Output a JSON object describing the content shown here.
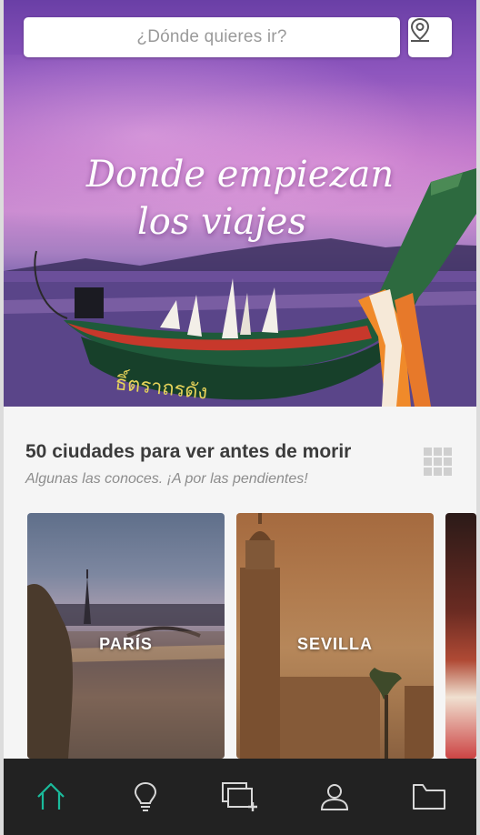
{
  "search": {
    "placeholder": "¿Dónde quieres ir?"
  },
  "hero": {
    "tagline_line1": "Donde empiezan",
    "tagline_line2": "los viajes"
  },
  "section": {
    "title": "50 ciudades para ver antes de morir",
    "subtitle": "Algunas las conoces. ¡A por las pendientes!"
  },
  "cards": [
    {
      "label": "PARÍS"
    },
    {
      "label": "SEVILLA"
    },
    {
      "label": ""
    }
  ],
  "tabbar": {
    "active_color": "#1abc9c",
    "inactive_color": "#d8d8d8",
    "tabs": [
      {
        "icon": "home-icon",
        "active": true
      },
      {
        "icon": "lightbulb-icon",
        "active": false
      },
      {
        "icon": "add-photo-icon",
        "active": false
      },
      {
        "icon": "user-icon",
        "active": false
      },
      {
        "icon": "folder-icon",
        "active": false
      }
    ]
  }
}
